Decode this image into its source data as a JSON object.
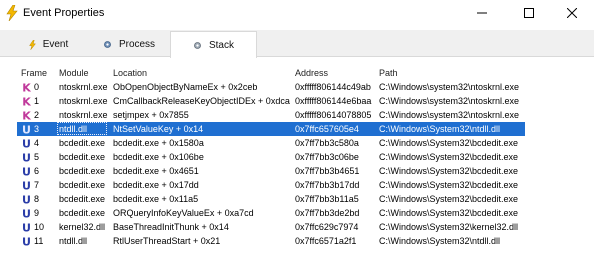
{
  "window": {
    "title": "Event Properties"
  },
  "tabs": [
    {
      "label": "Event",
      "icon": "lightning-icon",
      "selected": false
    },
    {
      "label": "Process",
      "icon": "gear-icon",
      "selected": false
    },
    {
      "label": "Stack",
      "icon": "stack-gear-icon",
      "selected": true
    }
  ],
  "table": {
    "columns": [
      "Frame",
      "Module",
      "Location",
      "Address",
      "Path"
    ],
    "rows": [
      {
        "kind": "K",
        "frame": "0",
        "module": "ntoskrnl.exe",
        "location": "ObOpenObjectByNameEx + 0x2ceb",
        "address": "0xfffff806144c49ab",
        "path": "C:\\Windows\\system32\\ntoskrnl.exe"
      },
      {
        "kind": "K",
        "frame": "1",
        "module": "ntoskrnl.exe",
        "location": "CmCallbackReleaseKeyObjectIDEx + 0xdca",
        "address": "0xfffff806144e6baa",
        "path": "C:\\Windows\\system32\\ntoskrnl.exe"
      },
      {
        "kind": "K",
        "frame": "2",
        "module": "ntoskrnl.exe",
        "location": "setjmpex + 0x7855",
        "address": "0xfffff80614078805",
        "path": "C:\\Windows\\system32\\ntoskrnl.exe"
      },
      {
        "kind": "U",
        "frame": "3",
        "module": "ntdll.dll",
        "location": "NtSetValueKey + 0x14",
        "address": "0x7ffc657605e4",
        "path": "C:\\Windows\\System32\\ntdll.dll",
        "selected": true
      },
      {
        "kind": "U",
        "frame": "4",
        "module": "bcdedit.exe",
        "location": "bcdedit.exe + 0x1580a",
        "address": "0x7ff7bb3c580a",
        "path": "C:\\Windows\\System32\\bcdedit.exe"
      },
      {
        "kind": "U",
        "frame": "5",
        "module": "bcdedit.exe",
        "location": "bcdedit.exe + 0x106be",
        "address": "0x7ff7bb3c06be",
        "path": "C:\\Windows\\System32\\bcdedit.exe"
      },
      {
        "kind": "U",
        "frame": "6",
        "module": "bcdedit.exe",
        "location": "bcdedit.exe + 0x4651",
        "address": "0x7ff7bb3b4651",
        "path": "C:\\Windows\\System32\\bcdedit.exe"
      },
      {
        "kind": "U",
        "frame": "7",
        "module": "bcdedit.exe",
        "location": "bcdedit.exe + 0x17dd",
        "address": "0x7ff7bb3b17dd",
        "path": "C:\\Windows\\System32\\bcdedit.exe"
      },
      {
        "kind": "U",
        "frame": "8",
        "module": "bcdedit.exe",
        "location": "bcdedit.exe + 0x11a5",
        "address": "0x7ff7bb3b11a5",
        "path": "C:\\Windows\\System32\\bcdedit.exe"
      },
      {
        "kind": "U",
        "frame": "9",
        "module": "bcdedit.exe",
        "location": "ORQueryInfoKeyValueEx + 0xa7cd",
        "address": "0x7ff7bb3de2bd",
        "path": "C:\\Windows\\System32\\bcdedit.exe"
      },
      {
        "kind": "U",
        "frame": "10",
        "module": "kernel32.dll",
        "location": "BaseThreadInitThunk + 0x14",
        "address": "0x7ffc629c7974",
        "path": "C:\\Windows\\System32\\kernel32.dll"
      },
      {
        "kind": "U",
        "frame": "11",
        "module": "ntdll.dll",
        "location": "RtlUserThreadStart + 0x21",
        "address": "0x7ffc6571a2f1",
        "path": "C:\\Windows\\System32\\ntdll.dll"
      }
    ]
  },
  "colors": {
    "kernel_icon": "#c0399b",
    "user_icon": "#2b3da8",
    "selection": "#1f6fd1"
  }
}
